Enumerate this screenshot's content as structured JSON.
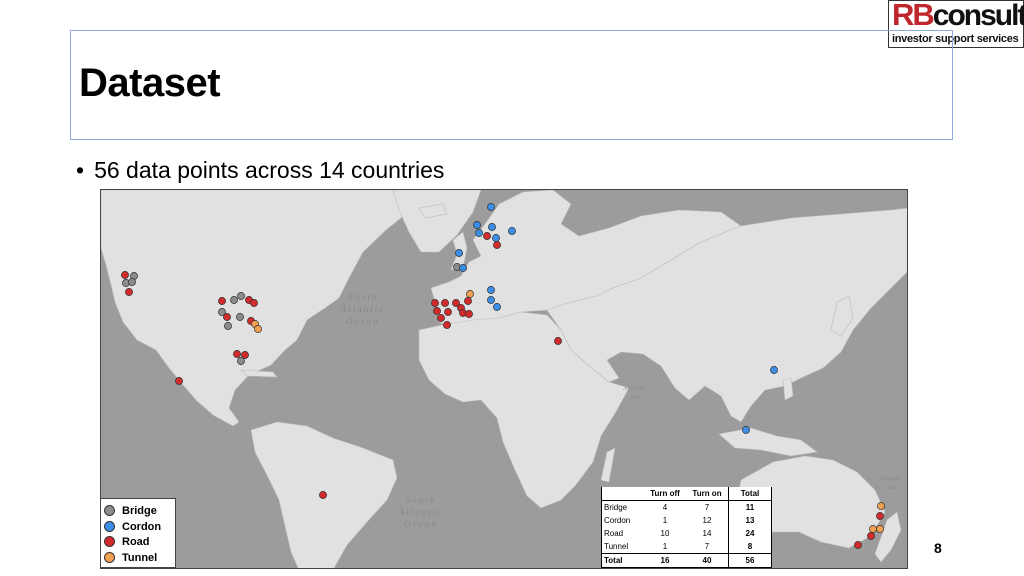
{
  "slide": {
    "title": "Dataset",
    "bullet": "56 data points across 14 countries",
    "page_number": "8"
  },
  "logo": {
    "brand_part1": "RB",
    "brand_part2": "consult",
    "tagline": "investor support services",
    "colors": {
      "rb": "#c0272d",
      "consult": "#111111"
    }
  },
  "map": {
    "ocean_labels": [
      "North",
      "Atlantic",
      "Ocean",
      "South",
      "Atlantic",
      "Ocean",
      "Arabian",
      "Sea",
      "Tasman",
      "Sea"
    ],
    "land_color": "#e1e1e1",
    "water_color": "#9c9c9c"
  },
  "legend": {
    "items": [
      {
        "label": "Bridge",
        "color": "#8c8c8c"
      },
      {
        "label": "Cordon",
        "color": "#3a8ee6"
      },
      {
        "label": "Road",
        "color": "#d12b2b"
      },
      {
        "label": "Tunnel",
        "color": "#f0a050"
      }
    ]
  },
  "summary_table": {
    "headers": [
      "",
      "Turn off",
      "Turn on",
      "Total"
    ],
    "rows": [
      [
        "Bridge",
        "4",
        "7",
        "11"
      ],
      [
        "Cordon",
        "1",
        "12",
        "13"
      ],
      [
        "Road",
        "10",
        "14",
        "24"
      ],
      [
        "Tunnel",
        "1",
        "7",
        "8"
      ]
    ],
    "total_row": [
      "Total",
      "16",
      "40",
      "56"
    ]
  }
}
